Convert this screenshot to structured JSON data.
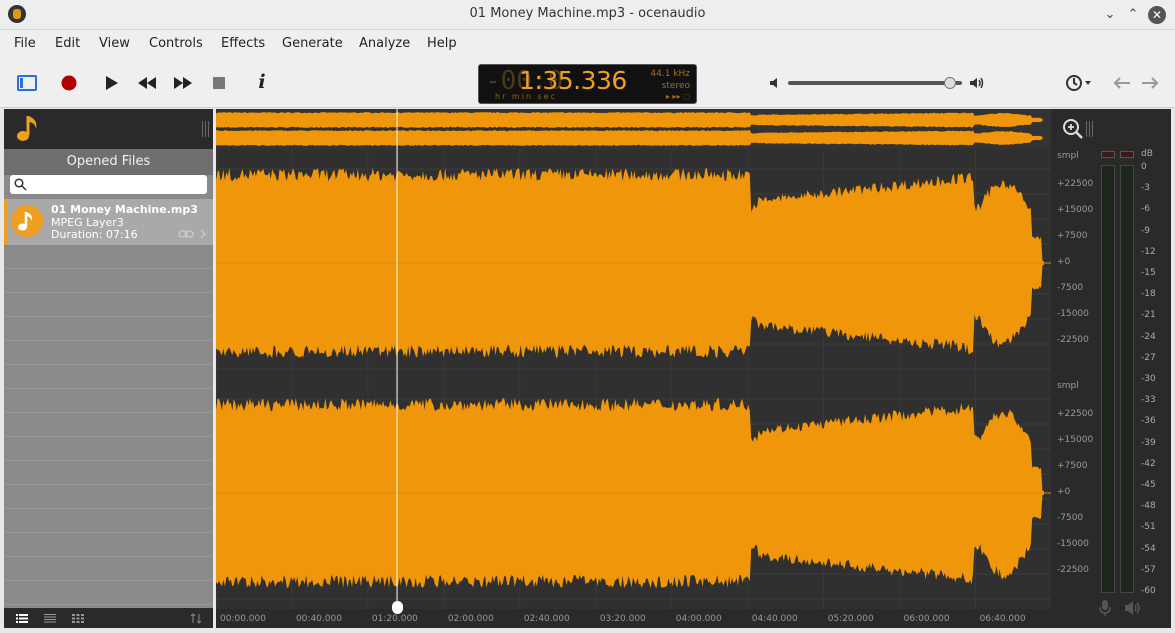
{
  "window": {
    "title": "01 Money Machine.mp3 - ocenaudio",
    "minimize_glyph": "⌄",
    "maximize_glyph": "⌃",
    "close_glyph": "✕"
  },
  "menu": [
    "File",
    "Edit",
    "View",
    "Controls",
    "Effects",
    "Generate",
    "Analyze",
    "Help"
  ],
  "toolbar": {
    "icons": [
      "sidebar-toggle-icon",
      "record-icon",
      "play-icon",
      "rewind-icon",
      "fast-forward-icon",
      "stop-icon",
      "info-icon",
      "volume-low-icon",
      "volume-high-icon",
      "history-clock-icon",
      "undo-arrow-icon",
      "redo-arrow-icon"
    ],
    "info_glyph": "i",
    "time_dim": "-00:0",
    "time_main": "1:35.336",
    "time_units": "hr    min  sec",
    "sample_rate": "44.1 kHz",
    "channels": "stereo",
    "clock_controls": "▸ ▸▸ ◌",
    "volume_level": 0.93,
    "accent": "#f0a020",
    "record_color": "#b00000"
  },
  "sidebar": {
    "section_title": "Opened Files",
    "search_placeholder": "",
    "files": [
      {
        "name": "01 Money Machine.mp3",
        "format": "MPEG Layer3",
        "duration": "Duration: 07:16"
      }
    ]
  },
  "waveform": {
    "color": "#f0960a",
    "background": "#303030",
    "playhead_time": "1:35.336",
    "total_duration_seconds": 436
  },
  "timeline_labels": [
    "00:00.000",
    "00:40.000",
    "01:20.000",
    "02:00.000",
    "02:40.000",
    "03:20.000",
    "04:00.000",
    "04:40.000",
    "05:20.000",
    "06:00.000",
    "06:40.000"
  ],
  "y_axis": {
    "unit": "smpl",
    "ticks": [
      "+22500",
      "+15000",
      "+7500",
      "+0",
      "-7500",
      "-15000",
      "-22500"
    ]
  },
  "meter": {
    "unit": "dB",
    "ticks": [
      "0",
      "-3",
      "-6",
      "-9",
      "-12",
      "-15",
      "-18",
      "-21",
      "-24",
      "-27",
      "-30",
      "-33",
      "-36",
      "-39",
      "-42",
      "-45",
      "-48",
      "-51",
      "-54",
      "-57",
      "-60"
    ]
  }
}
